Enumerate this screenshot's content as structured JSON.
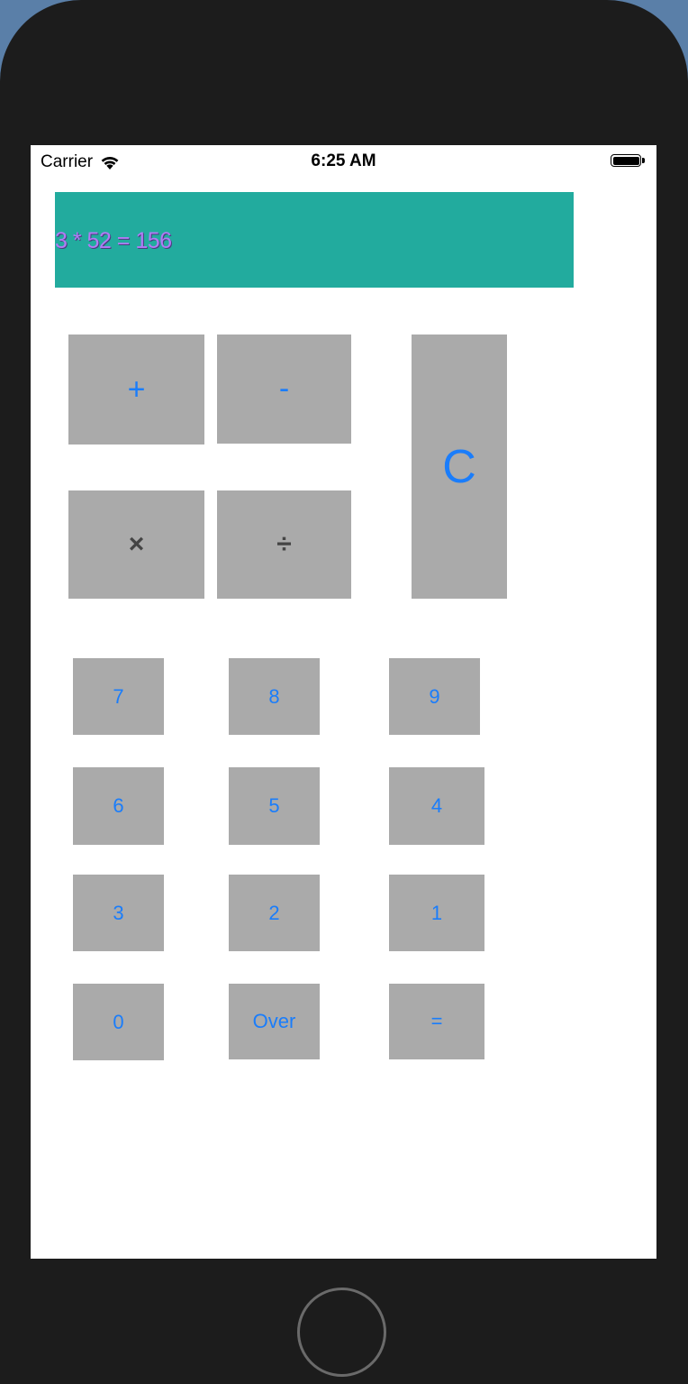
{
  "status_bar": {
    "carrier": "Carrier",
    "time": "6:25 AM",
    "icons": [
      "wifi-icon",
      "battery-icon"
    ]
  },
  "display": {
    "text": "3 * 52 = 156"
  },
  "operators": {
    "plus": "+",
    "minus": "-",
    "multiply": "×",
    "divide": "÷",
    "clear": "C"
  },
  "keys": {
    "k7": "7",
    "k8": "8",
    "k9": "9",
    "k6": "6",
    "k5": "5",
    "k4": "4",
    "k3": "3",
    "k2": "2",
    "k1": "1",
    "k0": "0",
    "over": "Over",
    "equals": "="
  },
  "colors": {
    "display_bg": "#22ab9e",
    "display_text": "#b07cf4",
    "button_bg": "#aaaaaa",
    "button_text": "#1a7dfb"
  }
}
